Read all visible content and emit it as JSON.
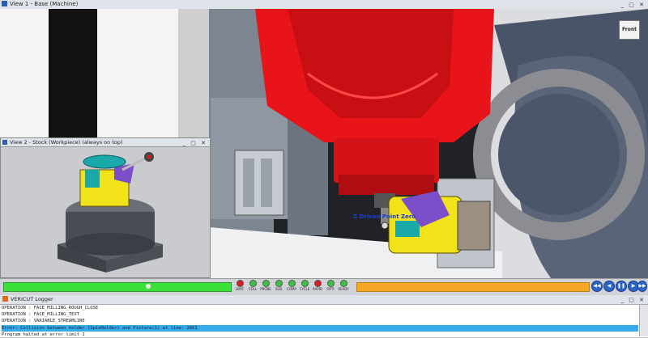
{
  "views": {
    "view1_title": "View 1 - Base (Machine)",
    "view2_title": "View 2 - Stock (Workpiece) (always on top)",
    "nav_cube_label": "Front",
    "scene_label": "Z Driven Point Zero"
  },
  "status": {
    "leds": [
      {
        "label": "LIMIT",
        "color": "#d62020"
      },
      {
        "label": "COLL",
        "color": "#3fc43f"
      },
      {
        "label": "PROBE",
        "color": "#3fc43f"
      },
      {
        "label": "SUB",
        "color": "#3fc43f"
      },
      {
        "label": "COMP",
        "color": "#3fc43f"
      },
      {
        "label": "CYCLE",
        "color": "#3fc43f"
      },
      {
        "label": "RAPID",
        "color": "#d62020"
      },
      {
        "label": "OPTI",
        "color": "#3fc43f"
      },
      {
        "label": "READY",
        "color": "#3fc43f"
      }
    ],
    "playback": [
      "◀◀",
      "◀",
      "❚❚",
      "▶",
      "▶▶"
    ],
    "green_progress": 0.64,
    "orange_progress": 1.0
  },
  "logger": {
    "title": "VERICUT Logger",
    "lines": [
      "OPERATION : FACE_MILLING_ROUGH_CLOSE",
      "OPERATION : FACE_MILLING_TEXT",
      "OPERATION : VARIABLE_STREAMLINE",
      "Error: Collision between holder (SpinHolder) and Fixture(1) at line: 2861",
      "Program halted at error limit 1"
    ],
    "selected_index": 3
  },
  "colors": {
    "spindle_red": "#e8141a",
    "stock_yellow": "#f2e21a",
    "teal": "#1aa8a8",
    "purple": "#7b4fc9",
    "green": "#3be03b",
    "orange": "#f5a623"
  }
}
